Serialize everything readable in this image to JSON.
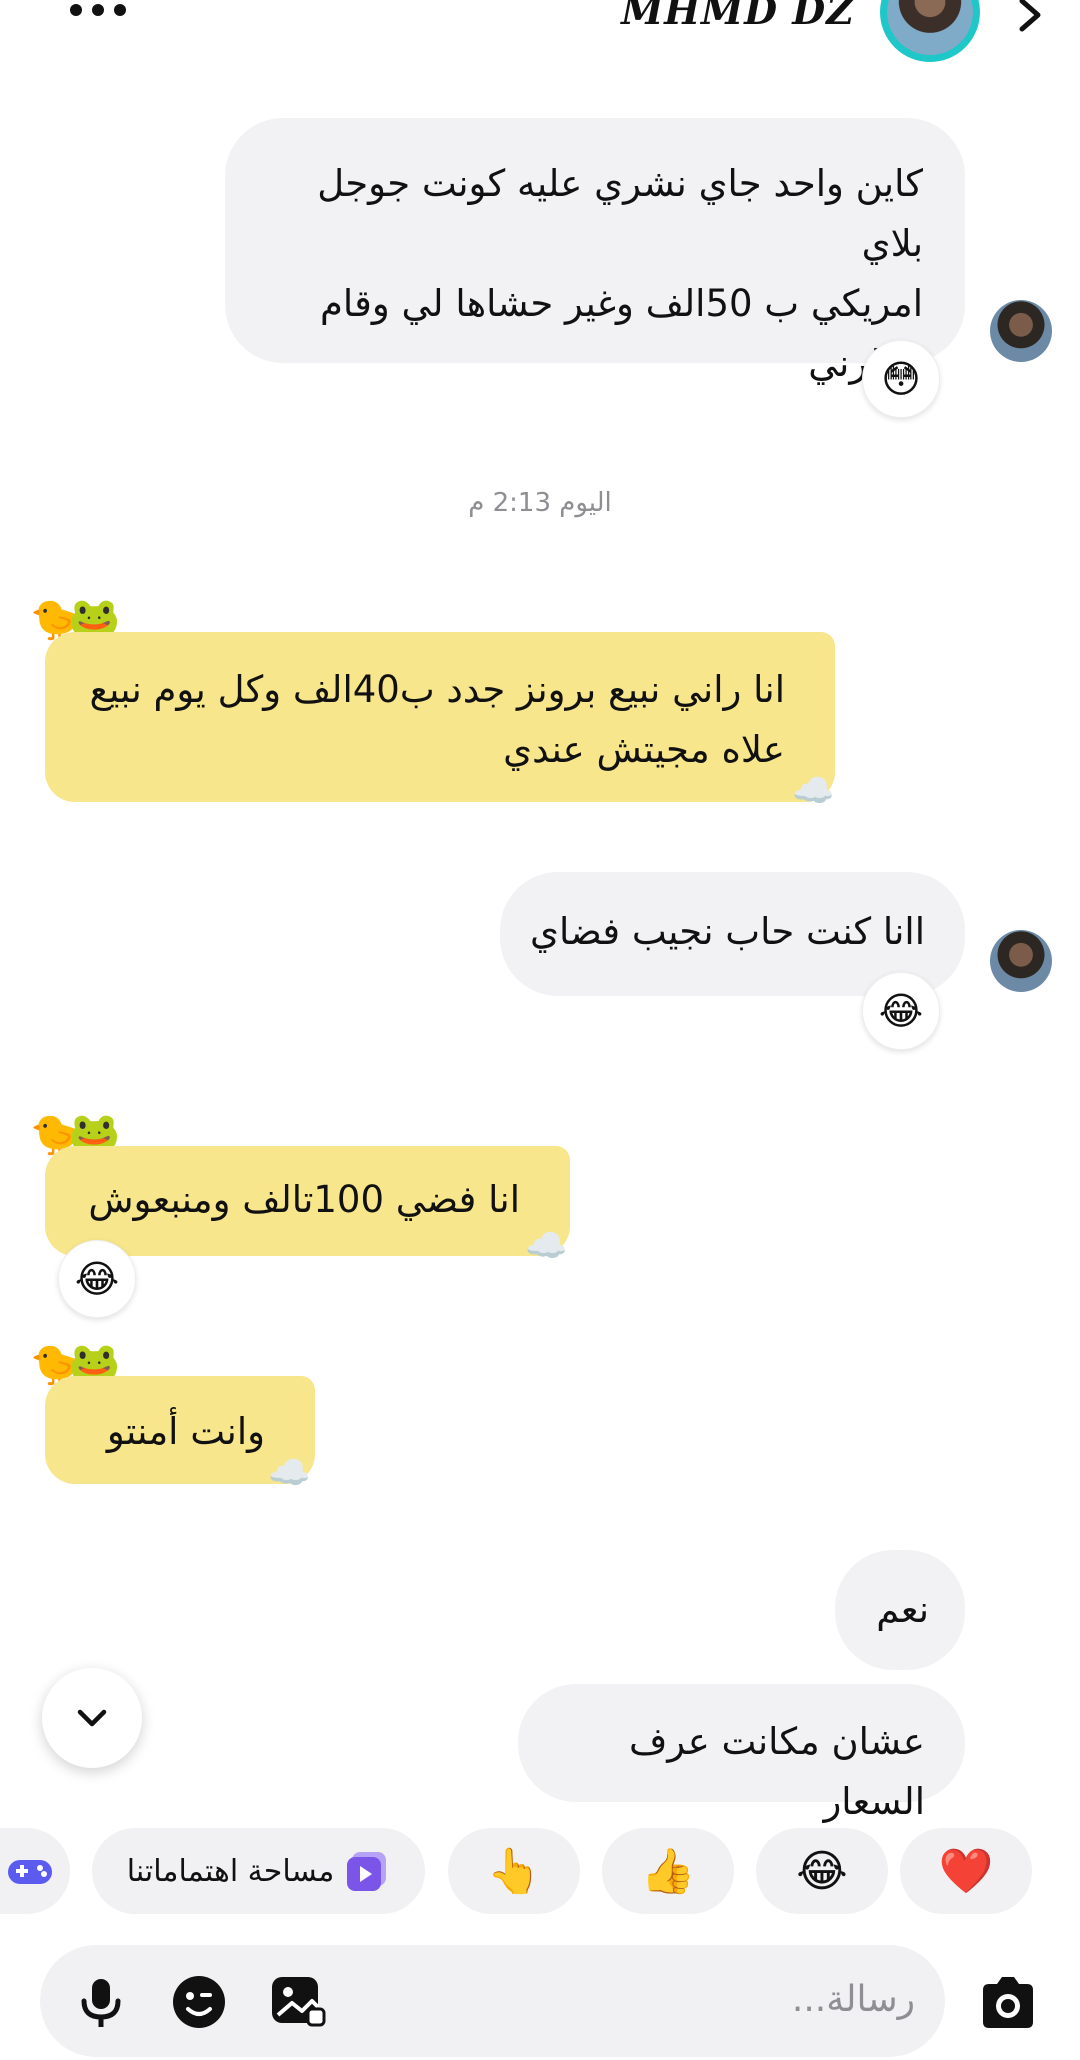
{
  "header": {
    "contact_name": "MHMD DZ"
  },
  "messages": [
    {
      "side": "mine",
      "lines": [
        "كاين واحد جاي نشري عليه كونت جوجل بلاي",
        "امريكي ب 50الف وغير حشاها لي وقام",
        "حطرني"
      ],
      "reaction": "😳"
    },
    {
      "timestamp": "اليوم 2:13 م"
    },
    {
      "side": "theirs",
      "lines": [
        "انا راني نبيع برونز جدد ب40الف وكل يوم نبيع",
        "علاه مجيتش عندي"
      ]
    },
    {
      "side": "mine",
      "lines": [
        "اانا كنت حاب نجيب فضاي"
      ],
      "reaction": "😂"
    },
    {
      "side": "theirs",
      "lines": [
        "انا فضي 100تالف ومنبعوش"
      ],
      "reaction": "😂"
    },
    {
      "side": "theirs",
      "lines": [
        "وانت أمنتو"
      ]
    },
    {
      "side": "mine",
      "lines": [
        "نعم"
      ]
    },
    {
      "side": "mine",
      "lines": [
        "عشان مكانت عرف السعار"
      ]
    }
  ],
  "quick_reactions": [
    "❤️",
    "😂",
    "👍",
    "👆"
  ],
  "interests_chip": "مساحة اهتماماتنا",
  "composer": {
    "placeholder": "رسالة..."
  },
  "icons": {
    "scroll": "chevron-down-icon",
    "mic": "microphone-icon",
    "sticker": "sticker-icon",
    "gallery": "gallery-icon",
    "camera": "camera-icon",
    "games": "game-controller-icon"
  }
}
